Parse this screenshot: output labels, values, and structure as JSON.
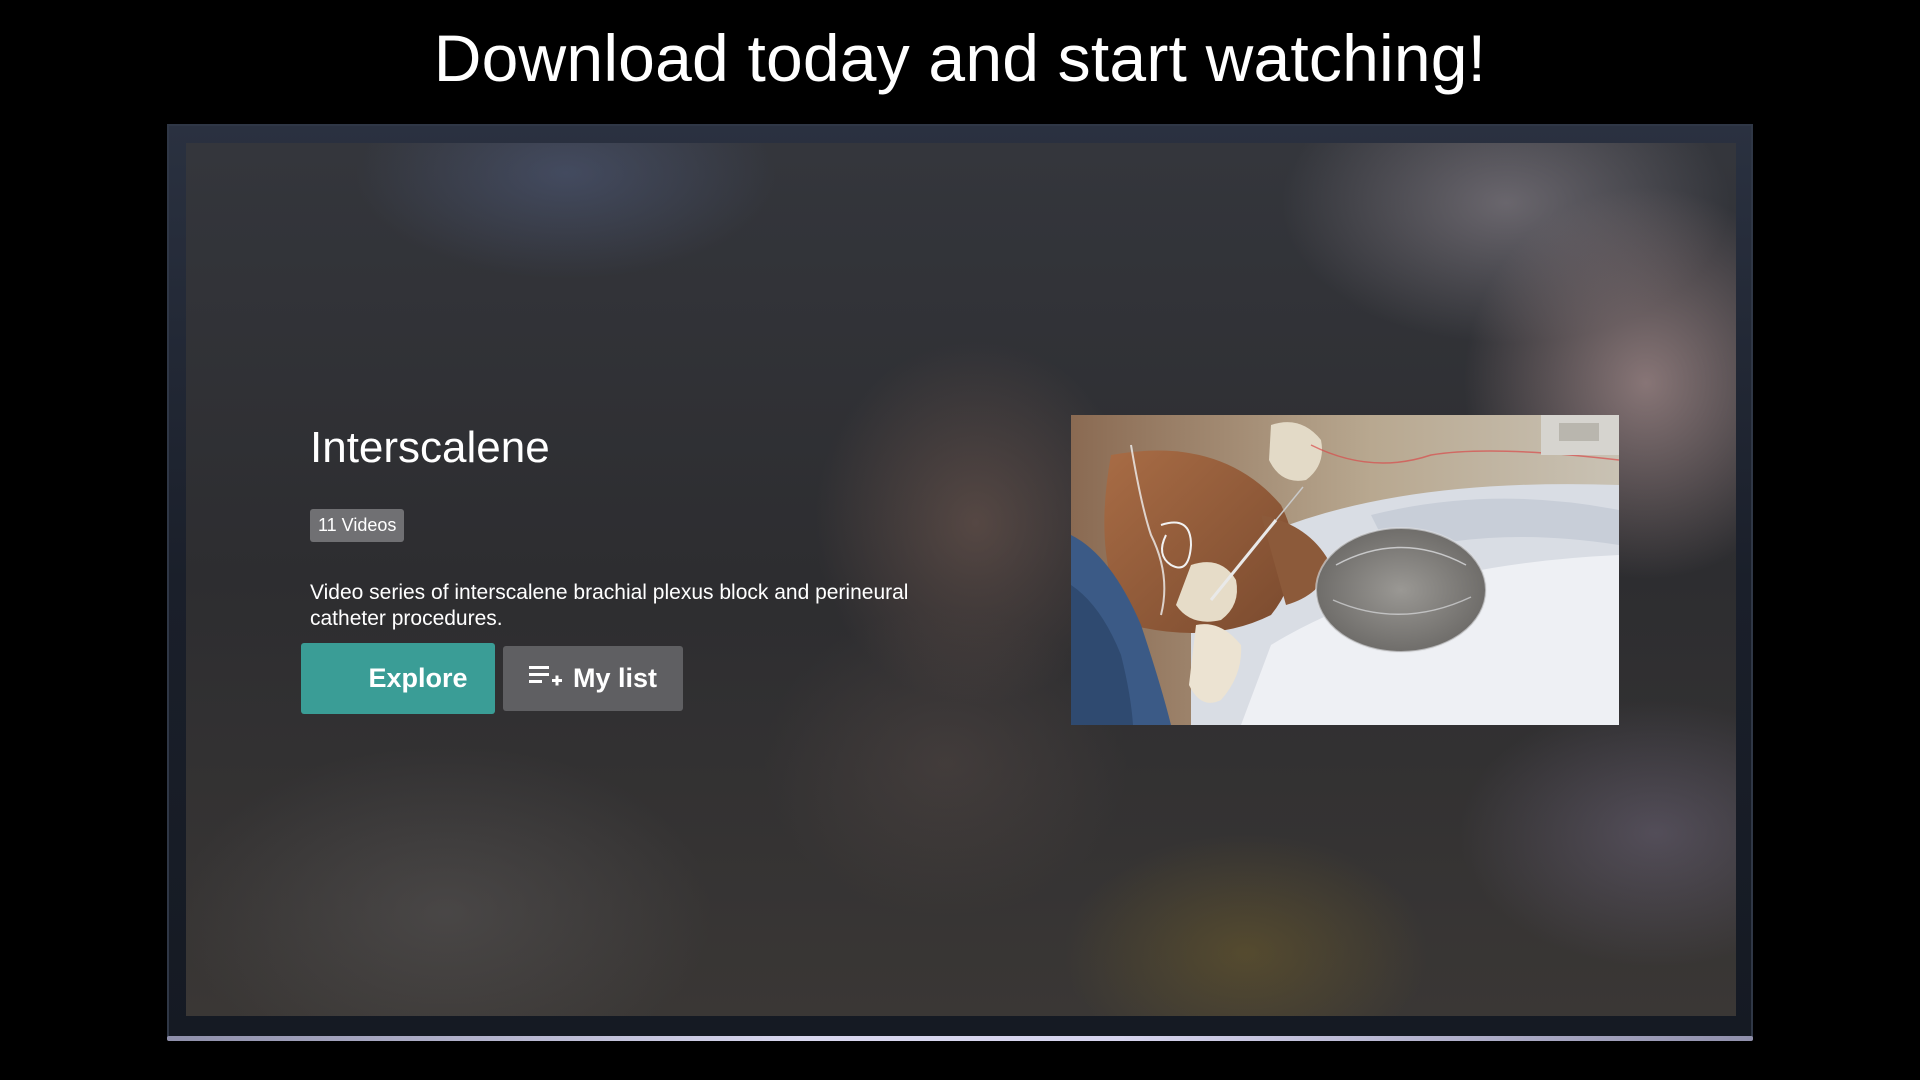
{
  "promo": {
    "headline": "Download today and start watching!"
  },
  "collection": {
    "title": "Interscalene",
    "video_count": "11 Videos",
    "description": "Video series of interscalene brachial plexus block and perineural catheter procedures."
  },
  "actions": {
    "explore": {
      "label": "Explore",
      "icon": "grid-icon"
    },
    "my_list": {
      "label": "My list",
      "icon": "playlist-add-icon"
    }
  },
  "thumbnail": {
    "subject": "interscalene-procedure-still"
  },
  "colors": {
    "accent": "#3a9d96",
    "secondary_button": "#5f5f62",
    "badge": "#87878a"
  }
}
